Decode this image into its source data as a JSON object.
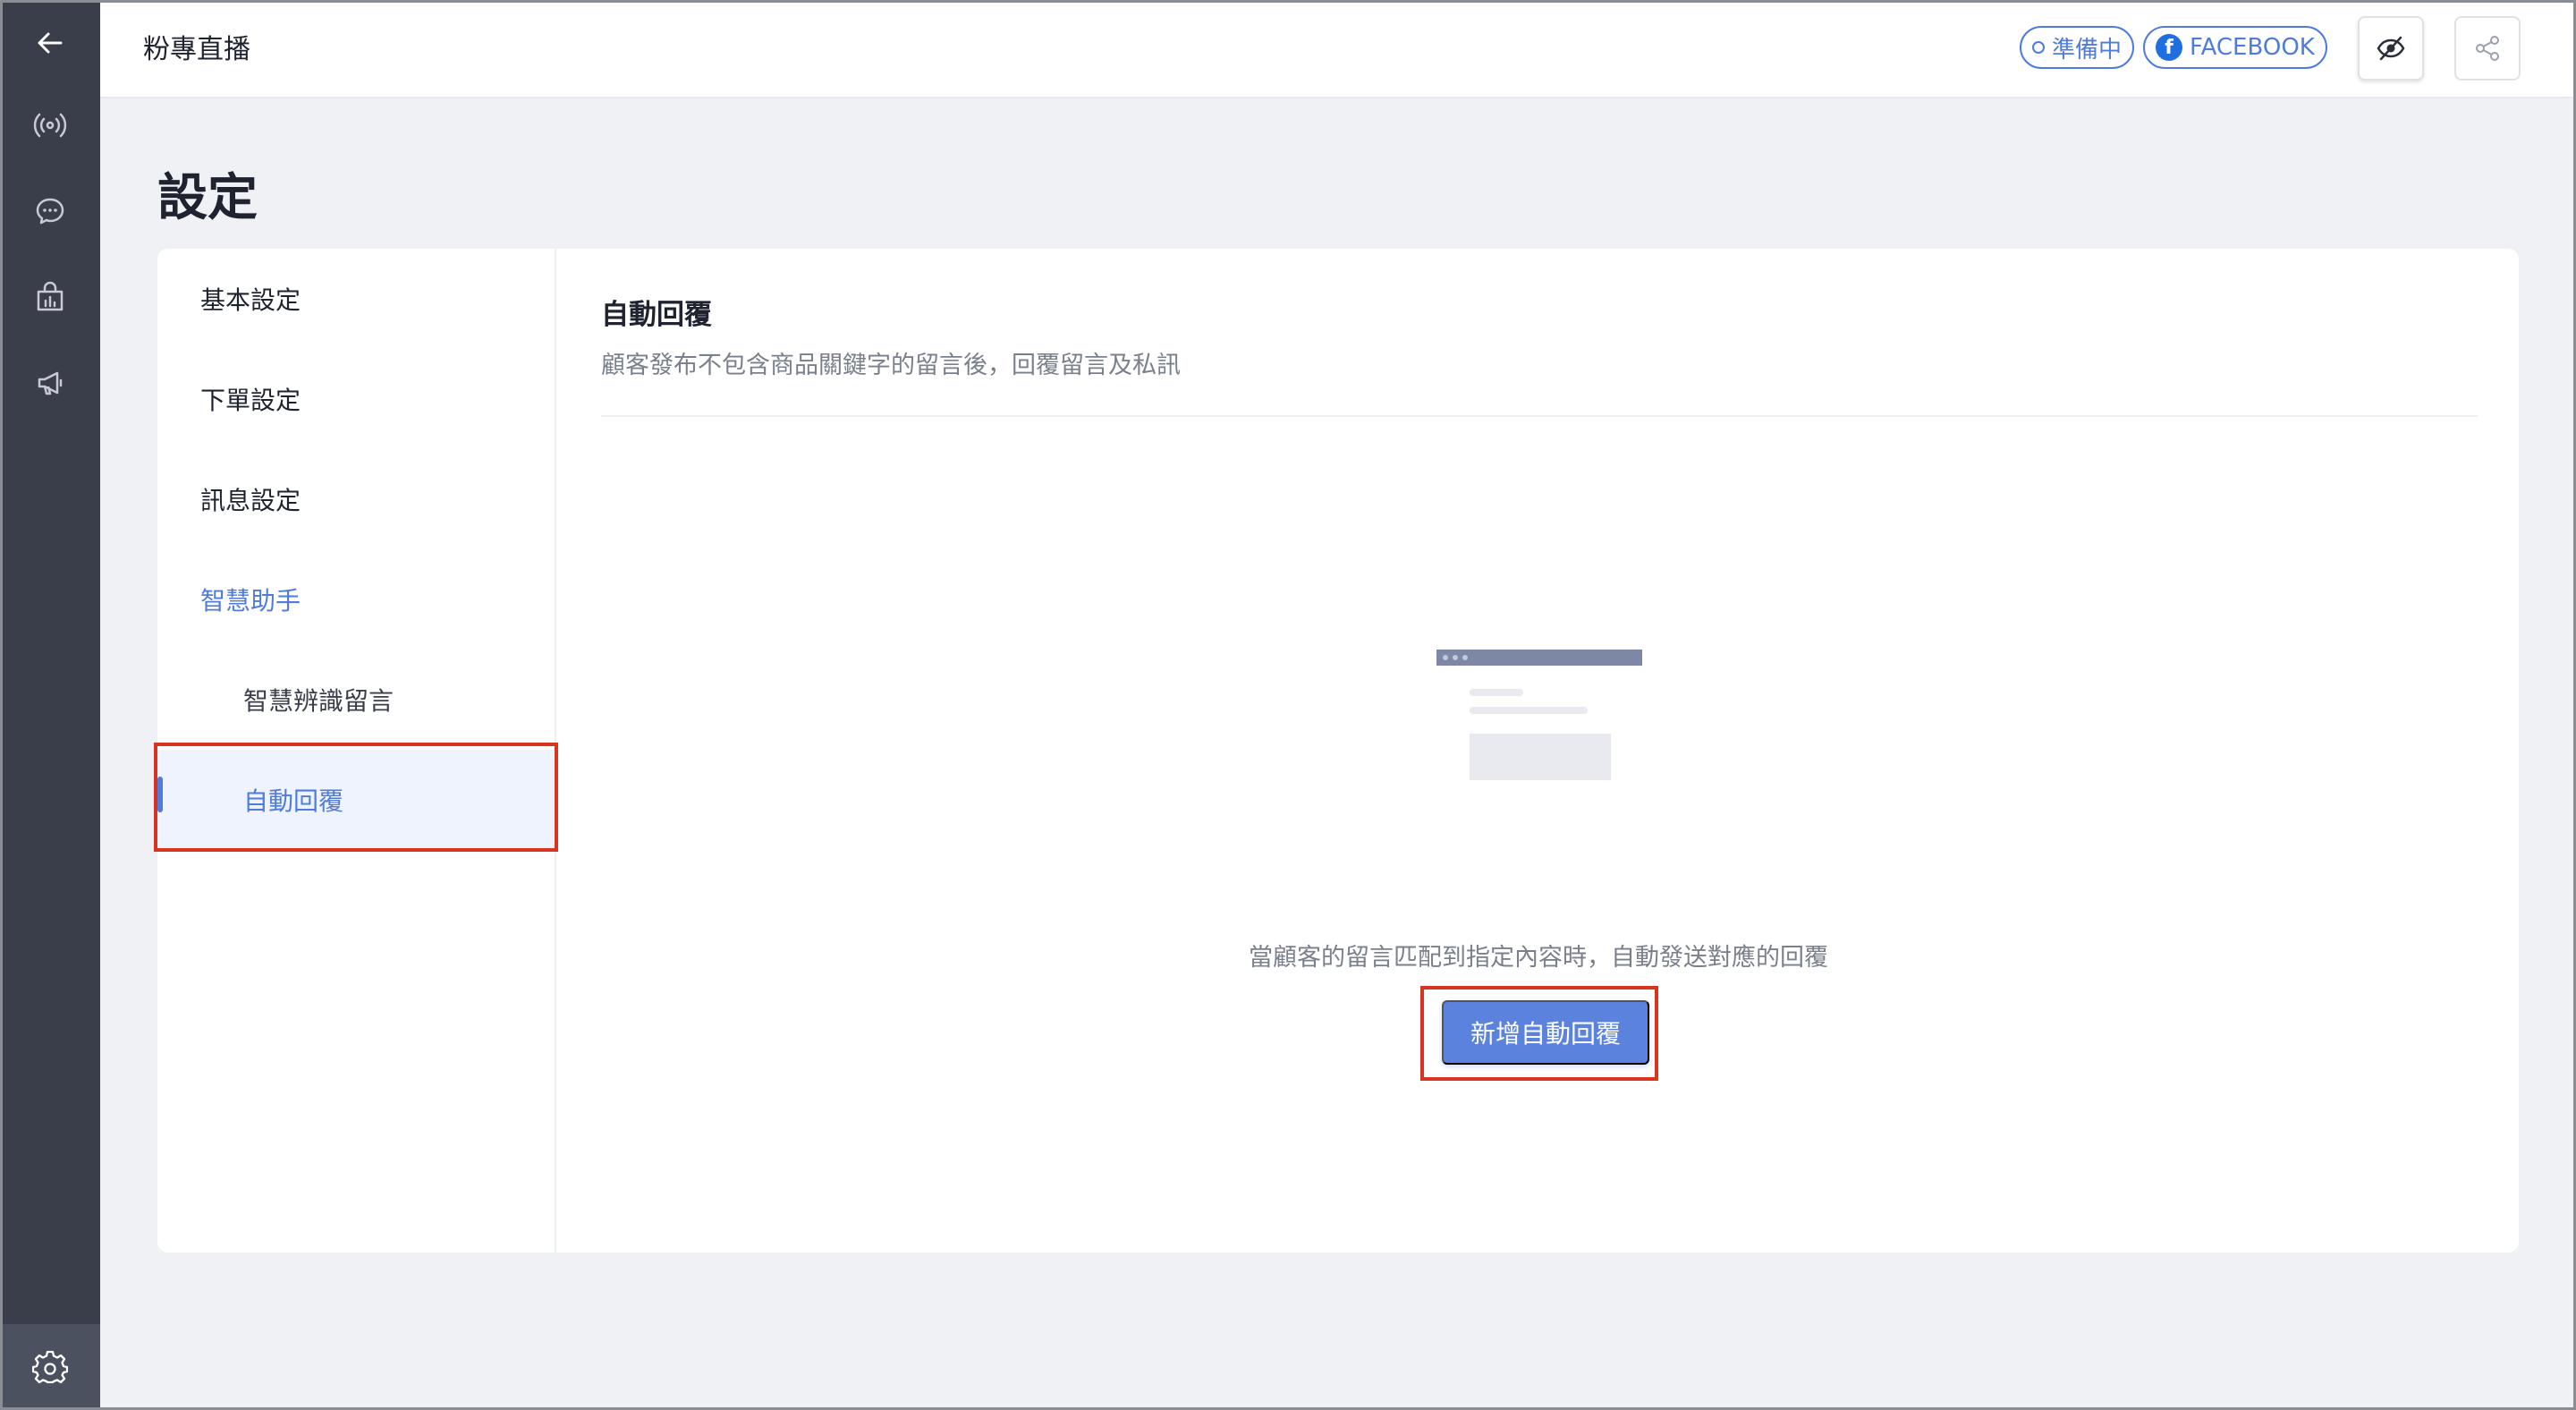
{
  "header": {
    "title": "粉專直播",
    "status_pill": "準備中",
    "platform_pill": "FACEBOOK"
  },
  "rail": {
    "items": [
      {
        "icon": "back-arrow-icon"
      },
      {
        "icon": "broadcast-icon"
      },
      {
        "icon": "chat-bubble-icon"
      },
      {
        "icon": "shop-stats-icon"
      },
      {
        "icon": "megaphone-icon"
      },
      {
        "icon": "gear-icon"
      }
    ]
  },
  "page": {
    "heading": "設定"
  },
  "settings_nav": {
    "items": [
      {
        "label": "基本設定"
      },
      {
        "label": "下單設定"
      },
      {
        "label": "訊息設定"
      },
      {
        "label": "智慧助手"
      },
      {
        "label": "智慧辨識留言"
      },
      {
        "label": "自動回覆"
      }
    ]
  },
  "content": {
    "title": "自動回覆",
    "description": "顧客發布不包含商品關鍵字的留言後，回覆留言及私訊",
    "empty_text": "當顧客的留言匹配到指定內容時，自動發送對應的回覆",
    "add_button": "新增自動回覆"
  },
  "colors": {
    "accent": "#4f7bdc",
    "rail_bg": "#3a3e4b",
    "highlight": "#d9341f",
    "page_bg": "#f0f1f5"
  }
}
